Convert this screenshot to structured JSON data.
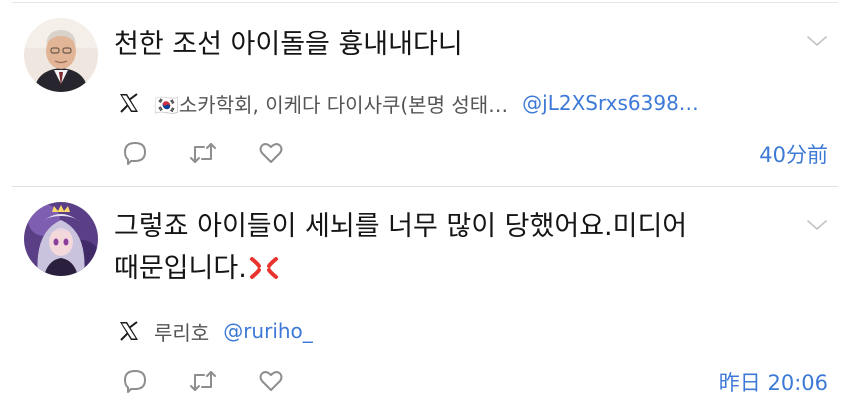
{
  "posts": [
    {
      "text_lines": [
        "천한 조선 아이돌을 흉내내다니"
      ],
      "author_name": "🇰🇷소카학회, 이케다 다이사쿠(본명 성태…",
      "author_handle": "@jL2XSrxs6398…",
      "time": "40分前",
      "icons": [
        "avatar-elderly-man",
        "chevron-down-icon",
        "x-logo-icon",
        "korea-flag-icon",
        "reply-icon",
        "repost-icon",
        "like-icon"
      ]
    },
    {
      "text_lines": [
        "그렇죠 아이들이 세뇌를 너무 많이 당했어요.미디어",
        "때문입니다."
      ],
      "emoji": "anger-symbol",
      "author_name": "루리호",
      "author_handle": "@ruriho_",
      "time": "昨日 20:06",
      "icons": [
        "avatar-anime-character",
        "chevron-down-icon",
        "x-logo-icon",
        "anger-emoji-icon",
        "reply-icon",
        "repost-icon",
        "like-icon"
      ]
    }
  ],
  "colors": {
    "link": "#3d79d6",
    "meta": "#555555",
    "icon": "#8e8e8e",
    "divider": "#e1e1e1",
    "anger": "#e8342c"
  }
}
